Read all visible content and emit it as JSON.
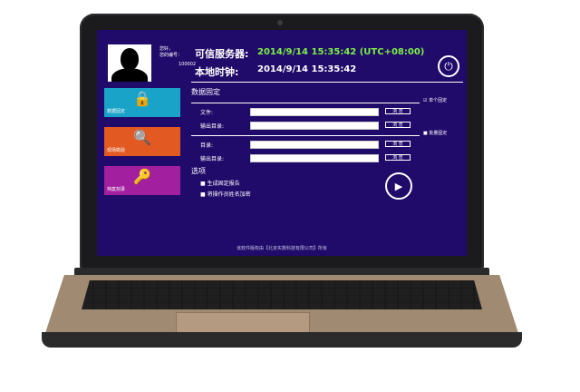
{
  "header": {
    "greeting": "您好，",
    "id_label": "您的编号：",
    "user_id": "100002",
    "trusted_server_label": "可信服务器:",
    "trusted_server_time": "2014/9/14 15:35:42  (UTC+08:00)",
    "local_clock_label": "本地时钟:",
    "local_clock_time": "2014/9/14 15:35:42"
  },
  "sidebar": {
    "items": [
      {
        "label": "数据固定",
        "icon": "padlock-icon",
        "color": "#1aa3c8"
      },
      {
        "label": "现场勘验",
        "icon": "magnifier-icon",
        "color": "#e25a22"
      },
      {
        "label": "档案刻录",
        "icon": "key-icon",
        "color": "#a21fa0"
      }
    ]
  },
  "main": {
    "section_title": "数据固定",
    "single": {
      "mode_label": "单个固定",
      "file_label": "文件:",
      "file_value": "",
      "output_label": "输出目录:",
      "output_value": "",
      "browse": "浏 览"
    },
    "batch": {
      "mode_label": "批量固定",
      "dir_label": "目录:",
      "dir_value": "",
      "output_label": "输出目录:",
      "output_value": "",
      "browse": "浏 览"
    },
    "options_title": "选项",
    "options": [
      {
        "label": "生成固定报告"
      },
      {
        "label": "将操作员姓名加密"
      }
    ]
  },
  "footer": {
    "copyright": "该软件版权由【北京实数科技有限公司】所有"
  },
  "colors": {
    "screen_bg": "#200a6a",
    "server_time": "#7cf045"
  }
}
